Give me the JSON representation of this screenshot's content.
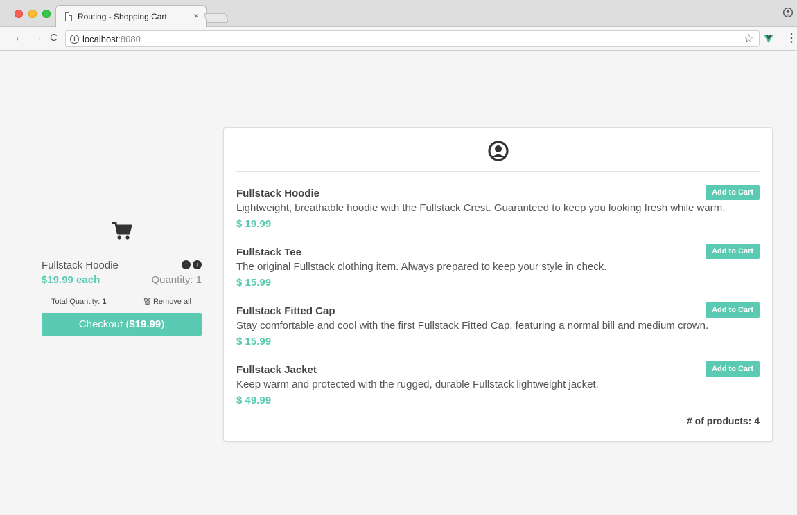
{
  "browser": {
    "tab_title": "Routing - Shopping Cart",
    "tab_close": "×",
    "url_host": "localhost",
    "url_port": ":8080",
    "back": "←",
    "forward": "→",
    "reload": "C",
    "star": "☆",
    "menu": "⋮",
    "info": "i"
  },
  "cart": {
    "icon": "shopping-cart-icon",
    "items": [
      {
        "name": "Fullstack Hoodie",
        "price_each": "$19.99 each",
        "quantity": "Quantity: 1",
        "increase_icon": "↑",
        "decrease_icon": "↓"
      }
    ],
    "total_quantity_label": "Total Quantity: ",
    "total_quantity_value": "1",
    "remove_all_label": "Remove all",
    "trash_icon": "🗑",
    "checkout_label": "Checkout (",
    "checkout_total": "$19.99",
    "checkout_suffix": ")"
  },
  "products": {
    "header_icon": "user-circle-icon",
    "add_to_cart_label": "Add to Cart",
    "items": [
      {
        "name": "Fullstack Hoodie",
        "description": "Lightweight, breathable hoodie with the Fullstack Crest. Guaranteed to keep you looking fresh while warm.",
        "price": "$ 19.99"
      },
      {
        "name": "Fullstack Tee",
        "description": "The original Fullstack clothing item. Always prepared to keep your style in check.",
        "price": "$ 15.99"
      },
      {
        "name": "Fullstack Fitted Cap",
        "description": "Stay comfortable and cool with the first Fullstack Fitted Cap, featuring a normal bill and medium crown.",
        "price": "$ 15.99"
      },
      {
        "name": "Fullstack Jacket",
        "description": "Keep warm and protected with the rugged, durable Fullstack lightweight jacket.",
        "price": "$ 49.99"
      }
    ],
    "count_label": "# of products: 4"
  },
  "colors": {
    "accent": "#5acbb2",
    "background": "#f5f5f5"
  }
}
